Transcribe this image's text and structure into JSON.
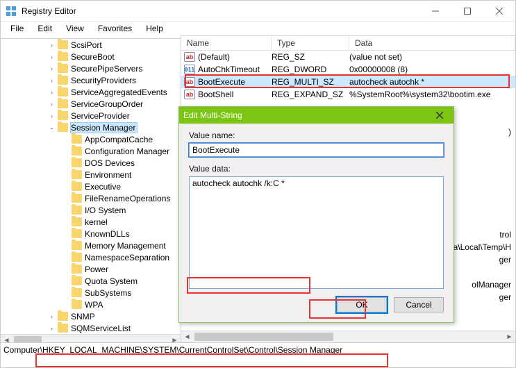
{
  "window": {
    "title": "Registry Editor"
  },
  "menus": [
    "File",
    "Edit",
    "View",
    "Favorites",
    "Help"
  ],
  "tree": [
    {
      "depth": 3,
      "exp": ">",
      "label": "ScsiPort"
    },
    {
      "depth": 3,
      "exp": ">",
      "label": "SecureBoot"
    },
    {
      "depth": 3,
      "exp": ">",
      "label": "SecurePipeServers"
    },
    {
      "depth": 3,
      "exp": ">",
      "label": "SecurityProviders"
    },
    {
      "depth": 3,
      "exp": ">",
      "label": "ServiceAggregatedEvents"
    },
    {
      "depth": 3,
      "exp": ">",
      "label": "ServiceGroupOrder"
    },
    {
      "depth": 3,
      "exp": ">",
      "label": "ServiceProvider"
    },
    {
      "depth": 3,
      "exp": "v",
      "label": "Session Manager",
      "selected": true
    },
    {
      "depth": 4,
      "exp": " ",
      "label": "AppCompatCache"
    },
    {
      "depth": 4,
      "exp": " ",
      "label": "Configuration Manager"
    },
    {
      "depth": 4,
      "exp": " ",
      "label": "DOS Devices"
    },
    {
      "depth": 4,
      "exp": " ",
      "label": "Environment"
    },
    {
      "depth": 4,
      "exp": " ",
      "label": "Executive"
    },
    {
      "depth": 4,
      "exp": " ",
      "label": "FileRenameOperations"
    },
    {
      "depth": 4,
      "exp": " ",
      "label": "I/O System"
    },
    {
      "depth": 4,
      "exp": " ",
      "label": "kernel"
    },
    {
      "depth": 4,
      "exp": " ",
      "label": "KnownDLLs"
    },
    {
      "depth": 4,
      "exp": " ",
      "label": "Memory Management"
    },
    {
      "depth": 4,
      "exp": " ",
      "label": "NamespaceSeparation"
    },
    {
      "depth": 4,
      "exp": " ",
      "label": "Power"
    },
    {
      "depth": 4,
      "exp": " ",
      "label": "Quota System"
    },
    {
      "depth": 4,
      "exp": " ",
      "label": "SubSystems"
    },
    {
      "depth": 4,
      "exp": " ",
      "label": "WPA"
    },
    {
      "depth": 3,
      "exp": ">",
      "label": "SNMP"
    },
    {
      "depth": 3,
      "exp": ">",
      "label": "SQMServiceList"
    }
  ],
  "columns": [
    "Name",
    "Type",
    "Data"
  ],
  "rows": [
    {
      "icon": "str",
      "name": "(Default)",
      "type": "REG_SZ",
      "data": "(value not set)"
    },
    {
      "icon": "bin",
      "name": "AutoChkTimeout",
      "type": "REG_DWORD",
      "data": "0x00000008 (8)"
    },
    {
      "icon": "str",
      "name": "BootExecute",
      "type": "REG_MULTI_SZ",
      "data": "autocheck autochk *",
      "selected": true
    },
    {
      "icon": "str",
      "name": "BootShell",
      "type": "REG_EXPAND_SZ",
      "data": "%SystemRoot%\\system32\\bootim.exe"
    }
  ],
  "obscured_fragments": {
    "frag1": ")",
    "frag2": "trol",
    "frag3": "AppData\\Local\\Temp\\H",
    "frag4": "ger",
    "frag5": "olManager",
    "frag6": "ger"
  },
  "dialog": {
    "title": "Edit Multi-String",
    "valueNameLabel": "Value name:",
    "valueName": "BootExecute",
    "valueDataLabel": "Value data:",
    "valueData": "autocheck autochk /k:C *",
    "ok": "OK",
    "cancel": "Cancel"
  },
  "status": {
    "prefix": "Computer",
    "path": "\\HKEY_LOCAL_MACHINE\\SYSTEM\\CurrentControlSet\\Control\\Session Manager"
  }
}
